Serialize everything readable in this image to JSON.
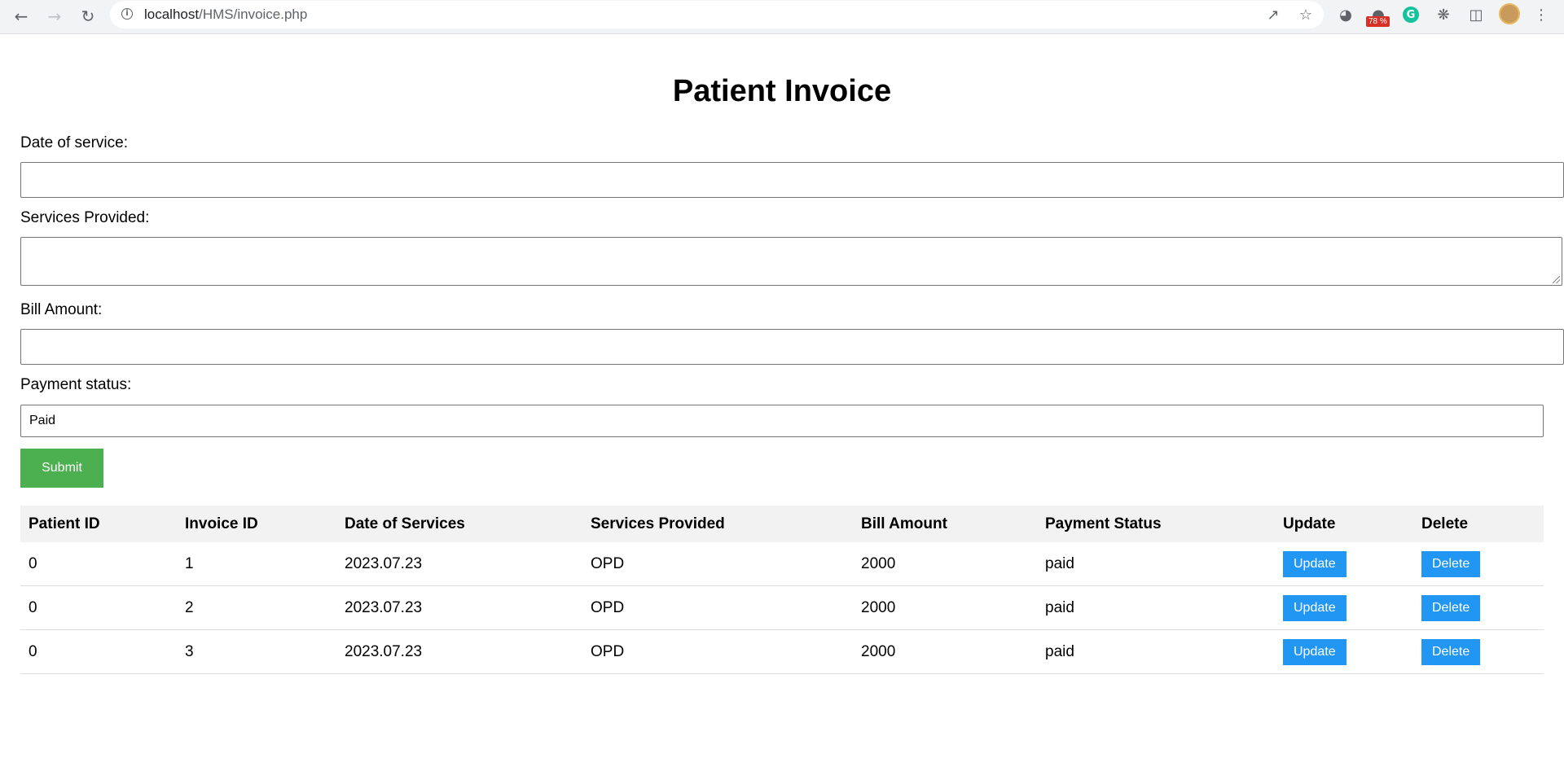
{
  "browser": {
    "url_host": "localhost",
    "url_path": "/HMS/invoice.php",
    "extension_badge": "78 %",
    "grammarly_letter": "G"
  },
  "page": {
    "title": "Patient Invoice",
    "form": {
      "date_label": "Date of service:",
      "date_value": "",
      "services_label": "Services Provided:",
      "services_value": "",
      "bill_label": "Bill Amount:",
      "bill_value": "",
      "payment_label": "Payment status:",
      "payment_value": "Paid",
      "submit_label": "Submit"
    },
    "table": {
      "headers": [
        "Patient ID",
        "Invoice ID",
        "Date of Services",
        "Services Provided",
        "Bill Amount",
        "Payment Status",
        "Update",
        "Delete"
      ],
      "rows": [
        {
          "patient_id": "0",
          "invoice_id": "1",
          "date": "2023.07.23",
          "services": "OPD",
          "amount": "2000",
          "status": "paid",
          "update": "Update",
          "delete": "Delete"
        },
        {
          "patient_id": "0",
          "invoice_id": "2",
          "date": "2023.07.23",
          "services": "OPD",
          "amount": "2000",
          "status": "paid",
          "update": "Update",
          "delete": "Delete"
        },
        {
          "patient_id": "0",
          "invoice_id": "3",
          "date": "2023.07.23",
          "services": "OPD",
          "amount": "2000",
          "status": "paid",
          "update": "Update",
          "delete": "Delete"
        }
      ]
    }
  },
  "colors": {
    "submit_bg": "#4caf50",
    "action_bg": "#2196f3",
    "header_bg": "#f2f2f2"
  },
  "icons": [
    "back-icon",
    "forward-icon",
    "reload-icon",
    "info-icon",
    "share-icon",
    "star-icon",
    "speedometer-icon",
    "extension-icon",
    "grammarly-icon",
    "puzzle-icon",
    "side-panel-icon",
    "avatar",
    "menu-icon"
  ]
}
